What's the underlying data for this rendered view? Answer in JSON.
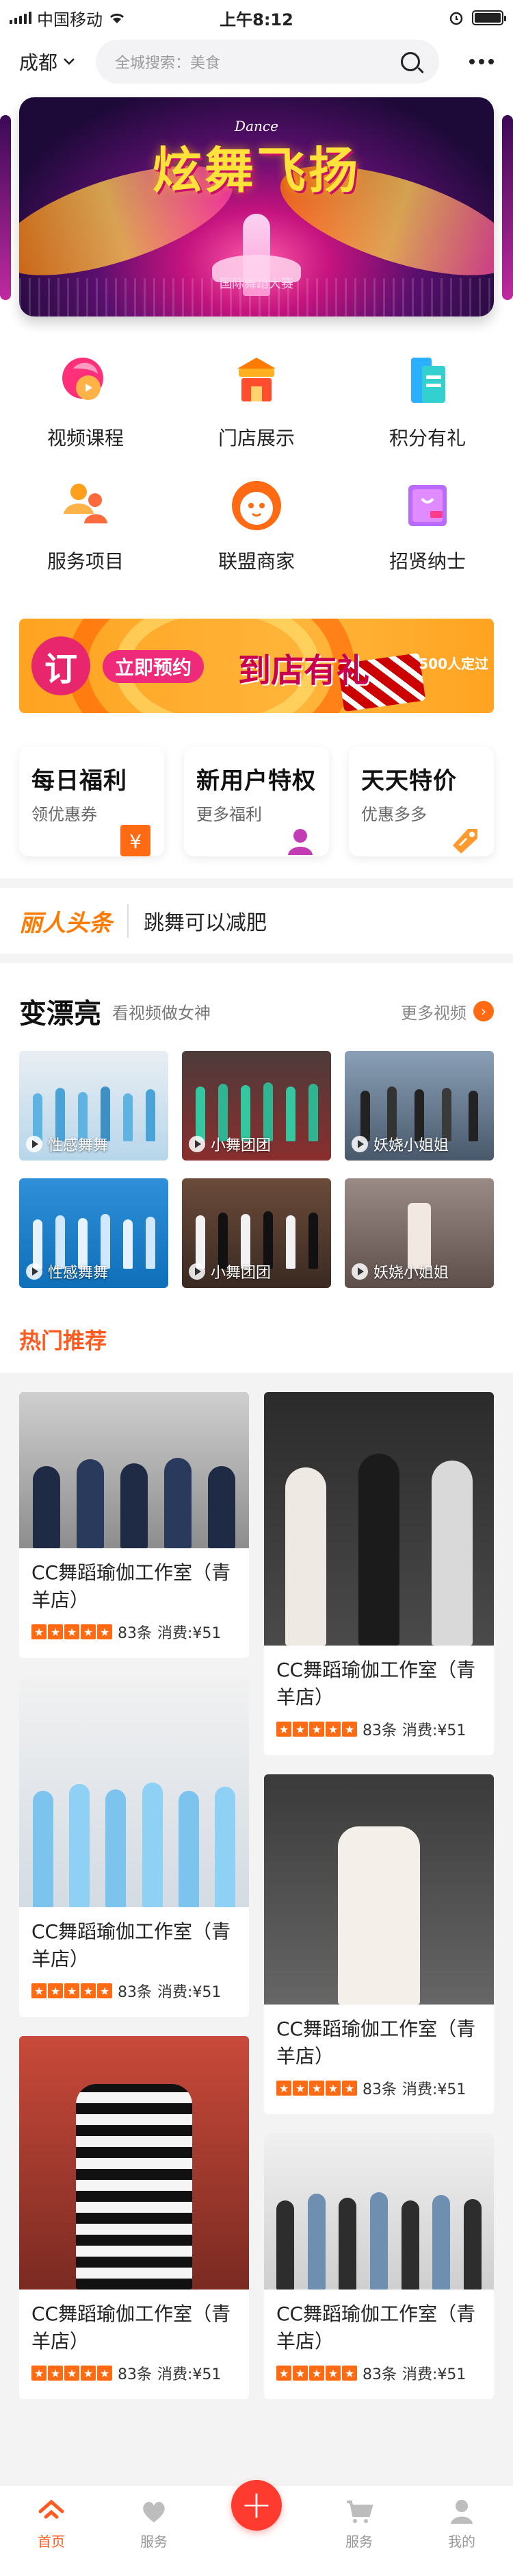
{
  "status": {
    "carrier": "中国移动",
    "time": "上午8:12"
  },
  "nav": {
    "city": "成都",
    "search_placeholder": "全城搜索：美食"
  },
  "banner": {
    "subtitle": "Dance",
    "title": "炫舞飞扬",
    "caption": "国际舞蹈大赛"
  },
  "grid": [
    {
      "label": "视频课程",
      "icon": "video-course-icon"
    },
    {
      "label": "门店展示",
      "icon": "store-icon"
    },
    {
      "label": "积分有礼",
      "icon": "points-gift-icon"
    },
    {
      "label": "服务项目",
      "icon": "service-icon"
    },
    {
      "label": "联盟商家",
      "icon": "merchant-icon"
    },
    {
      "label": "招贤纳士",
      "icon": "recruit-icon"
    }
  ],
  "promo": {
    "badge": "订",
    "button": "立即预约",
    "big": "到店有礼",
    "tag": "500人定过"
  },
  "cards": [
    {
      "title": "每日福利",
      "sub": "领优惠券",
      "icon": "coupon-yen-icon"
    },
    {
      "title": "新用户特权",
      "sub": "更多福利",
      "icon": "user-icon"
    },
    {
      "title": "天天特价",
      "sub": "优惠多多",
      "icon": "tag-icon"
    }
  ],
  "headline": {
    "logo": "丽人头条",
    "text": "跳舞可以减肥"
  },
  "videos": {
    "title": "变漂亮",
    "subtitle": "看视频做女神",
    "more": "更多视频",
    "items": [
      "性感舞舞",
      "小舞团团",
      "妖娆小姐姐",
      "性感舞舞",
      "小舞团团",
      "妖娆小姐姐"
    ]
  },
  "hot": {
    "title": "热门推荐"
  },
  "feed": {
    "left": [
      {
        "title": "CC舞蹈瑜伽工作室（青羊店）",
        "reviews": "83条",
        "price": "消费:¥51"
      },
      {
        "title": "CC舞蹈瑜伽工作室（青羊店）",
        "reviews": "83条",
        "price": "消费:¥51"
      },
      {
        "title": "CC舞蹈瑜伽工作室（青羊店）",
        "reviews": "83条",
        "price": "消费:¥51"
      }
    ],
    "right": [
      {
        "title": "CC舞蹈瑜伽工作室（青羊店）",
        "reviews": "83条",
        "price": "消费:¥51"
      },
      {
        "title": "CC舞蹈瑜伽工作室（青羊店）",
        "reviews": "83条",
        "price": "消费:¥51"
      },
      {
        "title": "CC舞蹈瑜伽工作室（青羊店）",
        "reviews": "83条",
        "price": "消费:¥51"
      }
    ]
  },
  "tabs": [
    {
      "label": "首页",
      "icon": "home-icon",
      "active": true
    },
    {
      "label": "服务",
      "icon": "heart-icon",
      "active": false
    },
    {
      "label": "",
      "icon": "plus-icon",
      "active": false
    },
    {
      "label": "服务",
      "icon": "cart-icon",
      "active": false
    },
    {
      "label": "我的",
      "icon": "profile-icon",
      "active": false
    }
  ],
  "colors": {
    "accent": "#ff5a1f",
    "plus": "#ff3b30",
    "promo": "#ffa321"
  }
}
